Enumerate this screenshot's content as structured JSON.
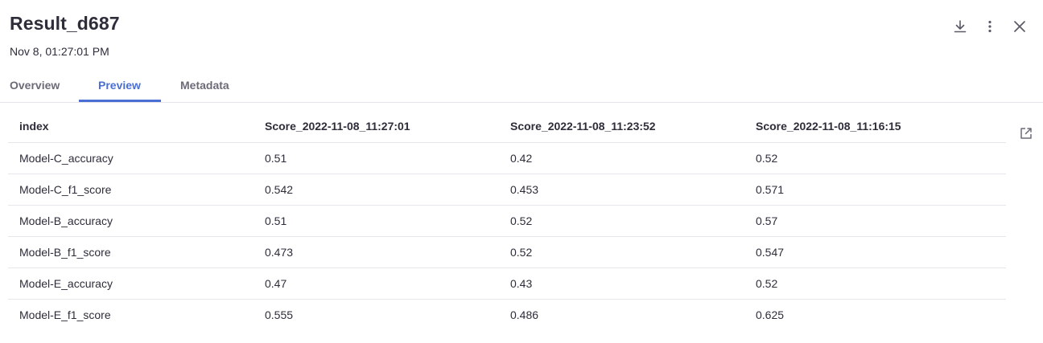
{
  "header": {
    "title": "Result_d687",
    "timestamp": "Nov 8, 01:27:01 PM"
  },
  "tabs": [
    {
      "label": "Overview",
      "active": false
    },
    {
      "label": "Preview",
      "active": true
    },
    {
      "label": "Metadata",
      "active": false
    }
  ],
  "actions": {
    "download_icon": "download-icon",
    "more_icon": "more-vertical-icon",
    "close_icon": "close-icon",
    "expand_icon": "open-external-icon"
  },
  "colors": {
    "accent": "#4a6fd4",
    "text": "#2e2d3a",
    "muted": "#6b6b78",
    "border": "#e6e6ec"
  },
  "table": {
    "columns": [
      "index",
      "Score_2022-11-08_11:27:01",
      "Score_2022-11-08_11:23:52",
      "Score_2022-11-08_11:16:15"
    ],
    "rows": [
      [
        "Model-C_accuracy",
        "0.51",
        "0.42",
        "0.52"
      ],
      [
        "Model-C_f1_score",
        "0.542",
        "0.453",
        "0.571"
      ],
      [
        "Model-B_accuracy",
        "0.51",
        "0.52",
        "0.57"
      ],
      [
        "Model-B_f1_score",
        "0.473",
        "0.52",
        "0.547"
      ],
      [
        "Model-E_accuracy",
        "0.47",
        "0.43",
        "0.52"
      ],
      [
        "Model-E_f1_score",
        "0.555",
        "0.486",
        "0.625"
      ]
    ]
  }
}
